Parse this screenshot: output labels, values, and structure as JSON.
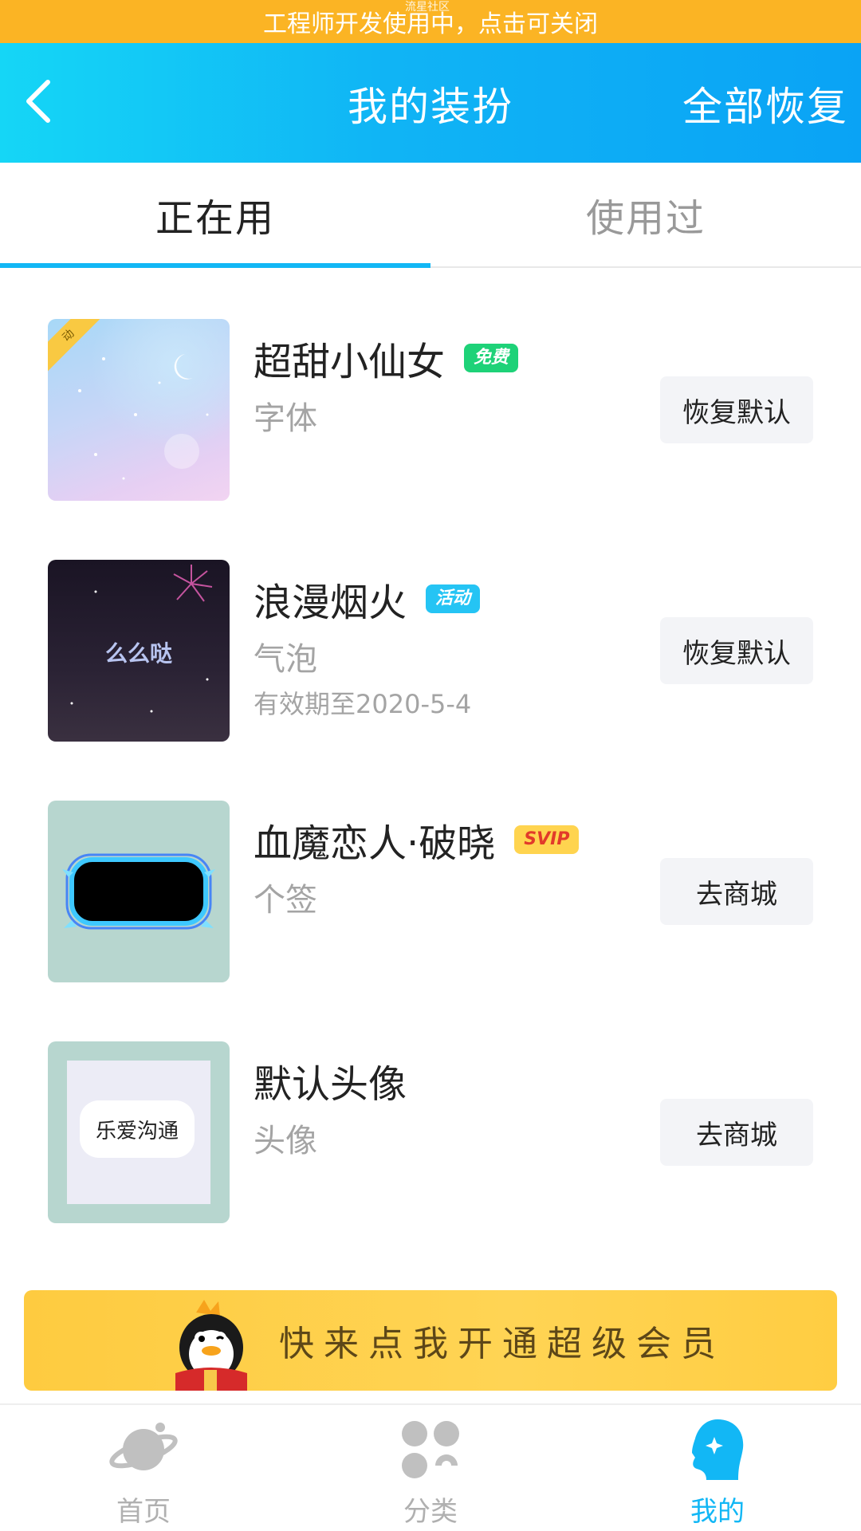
{
  "dev_banner": {
    "text": "工程师开发使用中，点击可关闭",
    "watermark": "流星社区"
  },
  "header": {
    "title": "我的装扮",
    "restore_all": "全部恢复",
    "back_icon": "chevron-left-icon"
  },
  "tabs": [
    {
      "label": "正在用",
      "active": true
    },
    {
      "label": "使用过",
      "active": false
    }
  ],
  "items": [
    {
      "title": "超甜小仙女",
      "tag": "免费",
      "category": "字体",
      "expiry": "",
      "action": "恢复默认",
      "corner_badge": "动",
      "thumb_label": ""
    },
    {
      "title": "浪漫烟火",
      "tag": "活动",
      "category": "气泡",
      "expiry": "有效期至2020-5-4",
      "action": "恢复默认",
      "thumb_label": "么么哒"
    },
    {
      "title": "血魔恋人·破晓",
      "tag": "SVIP",
      "category": "个签",
      "expiry": "",
      "action": "去商城",
      "thumb_label": ""
    },
    {
      "title": "默认头像",
      "tag": "",
      "category": "头像",
      "expiry": "",
      "action": "去商城",
      "thumb_label": "乐爱沟通"
    }
  ],
  "vip_banner": {
    "text": "快来点我开通超级会员"
  },
  "bottom_nav": [
    {
      "label": "首页",
      "icon": "planet-icon",
      "active": false
    },
    {
      "label": "分类",
      "icon": "category-grid-icon",
      "active": false
    },
    {
      "label": "我的",
      "icon": "profile-head-icon",
      "active": true
    }
  ],
  "colors": {
    "accent": "#12b7f5",
    "dev_banner": "#fbb424",
    "vip_banner": "#fecb40",
    "tag_free": "#1ed278",
    "tag_event": "#25c4f4",
    "tag_svip": "#ffd44f"
  }
}
